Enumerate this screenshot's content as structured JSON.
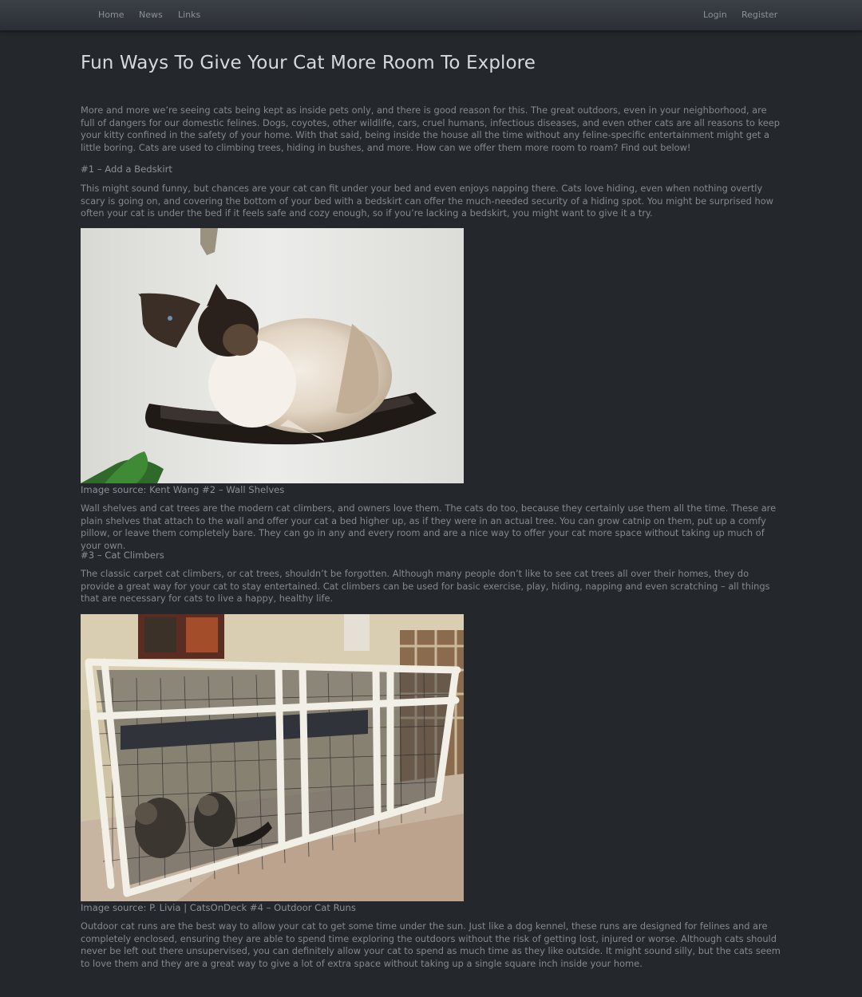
{
  "nav": {
    "left": [
      "Home",
      "News",
      "Links"
    ],
    "right": [
      "Login",
      "Register"
    ]
  },
  "article": {
    "title": "Fun Ways To Give Your Cat More Room To Explore",
    "intro": "More and more we’re seeing cats being kept as inside pets only, and there is good reason for this. The great outdoors, even in your neighborhood, are full of dangers for our domestic felines. Dogs, coyotes, other wildlife, cars, cruel humans, infectious diseases, and even other cats are all reasons to keep your kitty confined in the safety of your home. With that said, being inside the house all the time without any feline-specific entertainment might get a little boring. Cats are used to climbing trees, hiding in bushes, and more. How can we offer them more room to roam? Find out below!",
    "section1_heading": "#1 – Add a Bedskirt",
    "section1_text": "This might sound funny, but chances are your cat can fit under your bed and even enjoys napping there. Cats love hiding, even when nothing overtly scary is going on, and covering the bottom of your bed with a bedskirt can offer the much-needed security of a hiding spot. You might be surprised how often your cat is under the bed if it feels safe and cozy enough, so if you’re lacking a bedskirt, you might want to give it a try.",
    "caption1": "Image source: Kent Wang #2 – Wall Shelves",
    "section2_text": "Wall shelves and cat trees are the modern cat climbers, and owners love them. The cats do too, because they certainly use them all the time. These are plain shelves that attach to the wall and offer your cat a bed higher up, as if they were in an actual tree. You can grow catnip on them, put up a comfy pillow, or leave them completely bare. They can go in any and every room and are a nice way to offer your cat more space without taking up much of your own.",
    "section3_heading": "#3 – Cat Climbers",
    "section3_text": "The classic carpet cat climbers, or cat trees, shouldn’t be forgotten. Although many people don’t like to see cat trees all over their homes, they do provide a great way for your cat to stay entertained. Cat climbers can be used for basic exercise, play, hiding, napping and even scratching – all things that are necessary for cats to live a happy, healthy life.",
    "caption2": "Image source: P. Livia | CatsOnDeck #4 – Outdoor Cat Runs",
    "section4_text": "Outdoor cat runs are the best way to allow your cat to get some time under the sun. Just like a dog kennel, these runs are designed for felines and are completely enclosed, ensuring they are able to spend time exploring the outdoors without the risk of getting lost, injured or worse. Although cats should never be left out there unsupervised, you can definitely allow your cat to spend as much time as they like outside. It might sound silly, but the cats seem to love them and they are a great way to give a lot of extra space without taking up a single square inch inside your home."
  },
  "colors": {
    "page_background": "#24272c",
    "navbar_top": "#3b4047",
    "navbar_bottom": "#2b2f35",
    "title_text": "#d7d9dc",
    "body_text": "#858990"
  }
}
